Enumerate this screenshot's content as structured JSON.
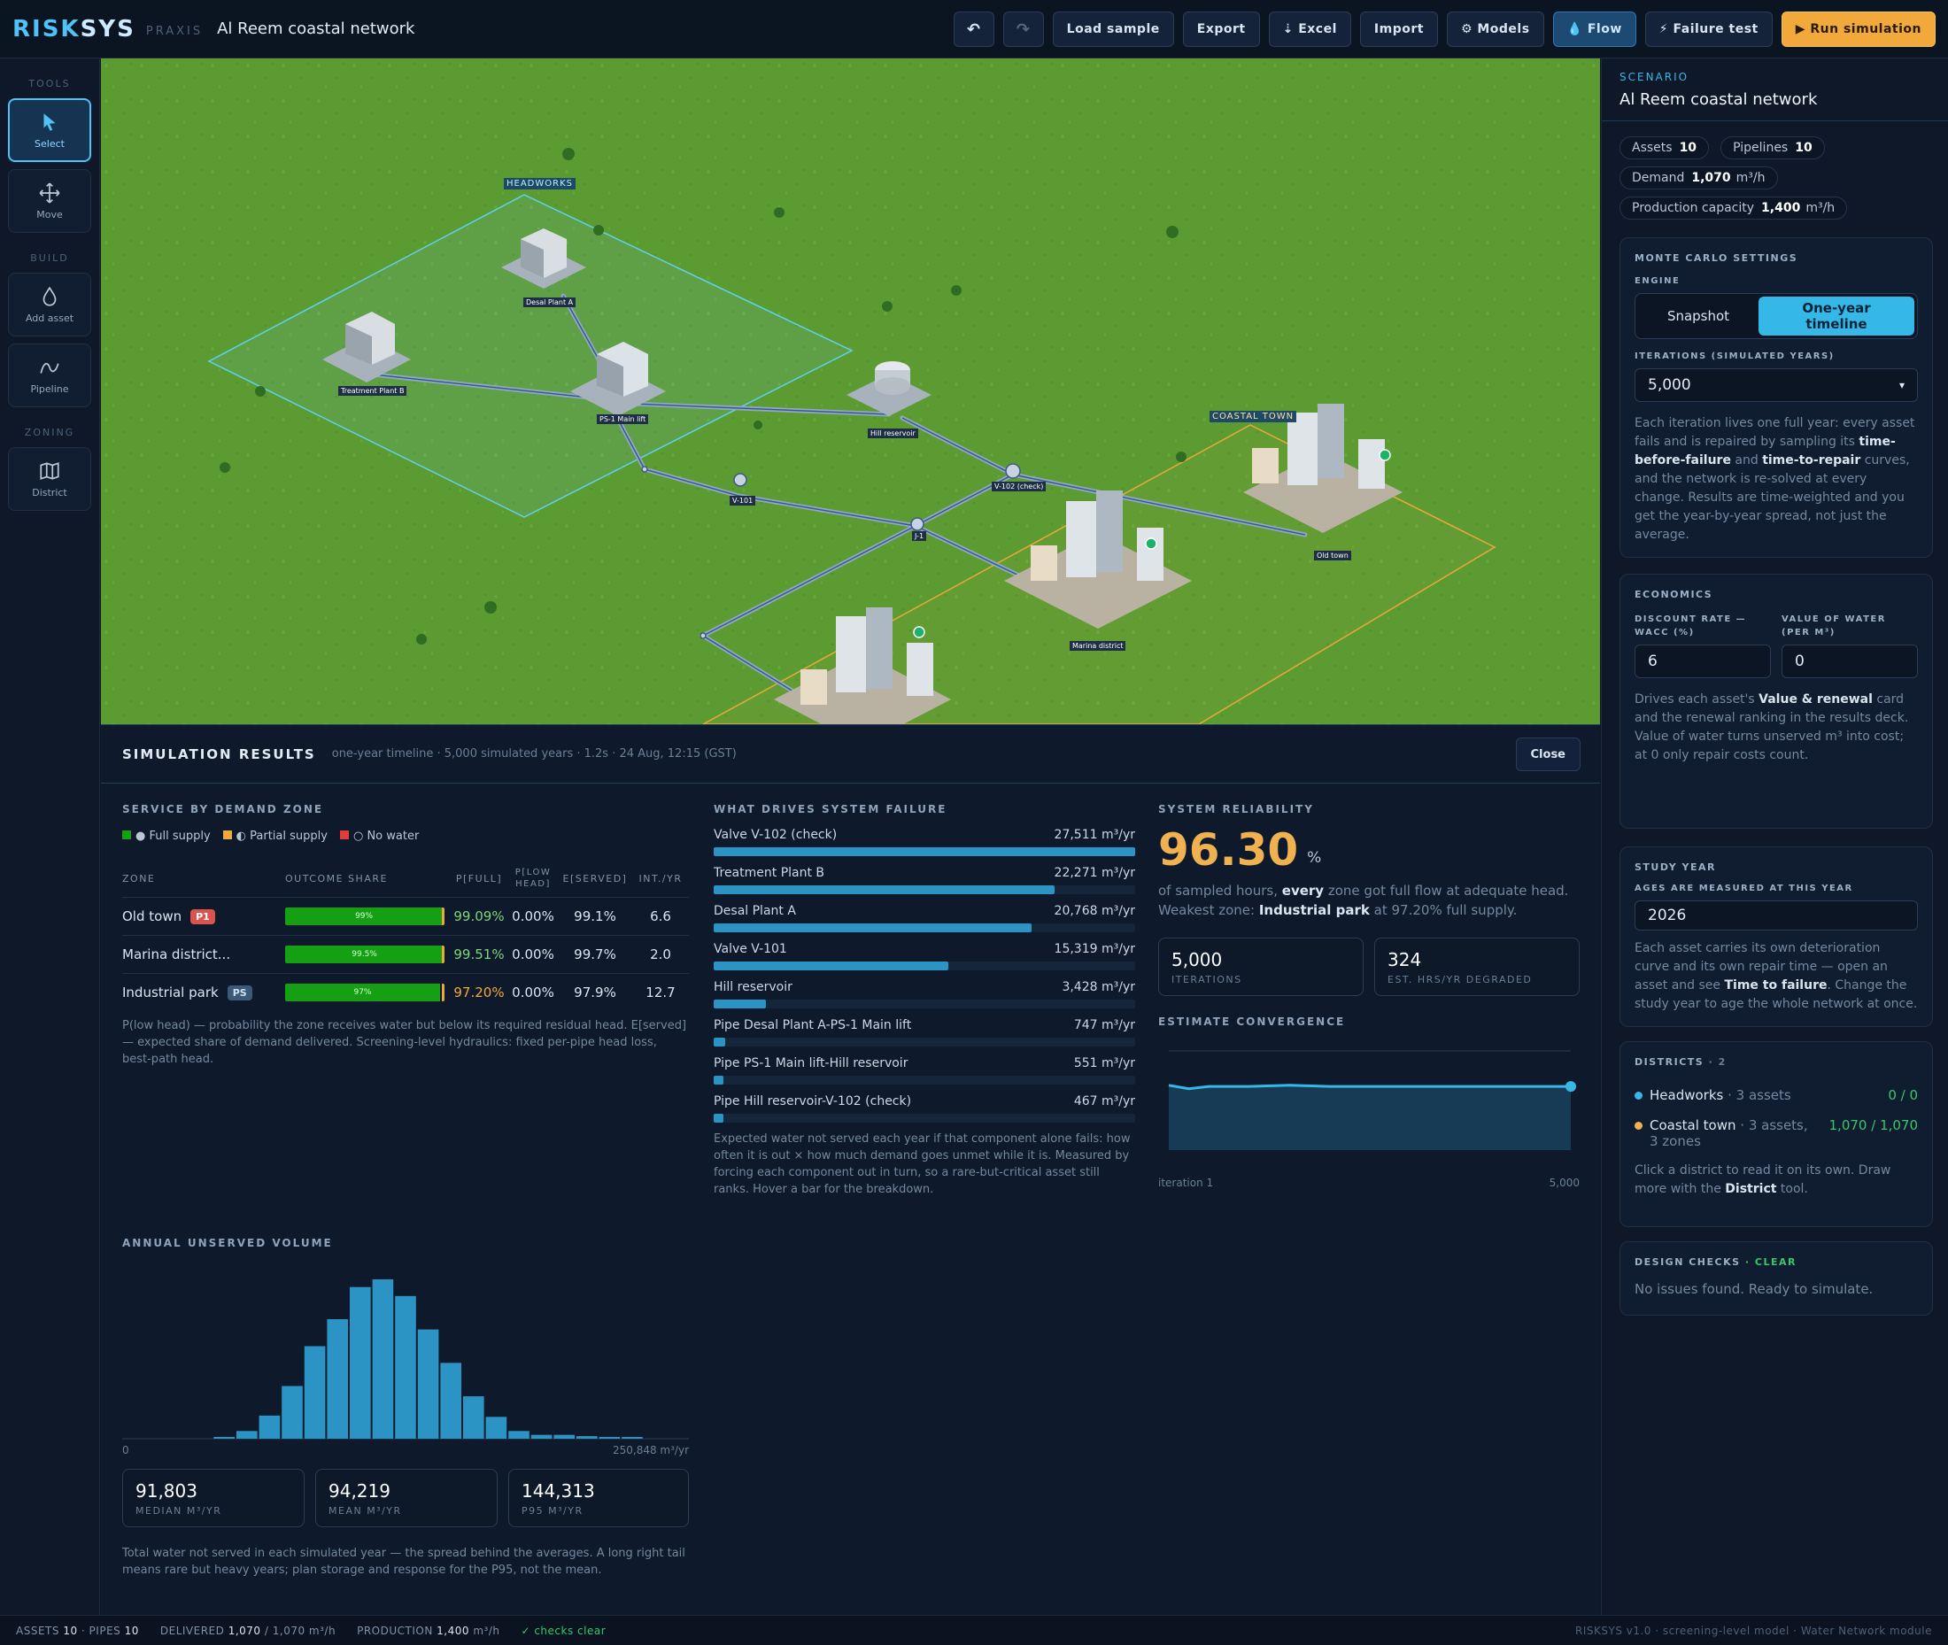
{
  "app": {
    "name_a": "RISK",
    "name_b": "SYS",
    "sub": "PRAXIS",
    "project": "Al Reem coastal network"
  },
  "toolbar": {
    "undo": "↶",
    "redo": "↷",
    "load_sample": "Load sample",
    "export": "Export",
    "excel": "⇣ Excel",
    "import": "Import",
    "models": "⚙ Models",
    "flow": "💧 Flow",
    "failure": "⚡ Failure test",
    "run": "▶ Run simulation"
  },
  "tools": {
    "sec_tools": "TOOLS",
    "select": "Select",
    "move": "Move",
    "sec_build": "BUILD",
    "add_asset": "Add asset",
    "pipeline": "Pipeline",
    "sec_zoning": "ZONING",
    "district": "District"
  },
  "map": {
    "headworks": "HEADWORKS",
    "coastal": "COASTAL TOWN",
    "desal": "Desal Plant A",
    "treatment": "Treatment Plant B",
    "ps1": "PS-1 Main lift",
    "hill": "Hill reservoir",
    "v101": "V-101",
    "v102": "V-102 (check)",
    "j1": "J-1",
    "oldtown": "Old town",
    "marina": "Marina district"
  },
  "results": {
    "title": "SIMULATION RESULTS",
    "meta": "one-year timeline · 5,000 simulated years · 1.2s · 24 Aug, 12:15 (GST)",
    "close": "Close",
    "zones_head": "SERVICE BY DEMAND ZONE",
    "legend": {
      "full": "● Full supply",
      "partial": "◐ Partial supply",
      "none": "○ No water"
    },
    "cols": {
      "zone": "ZONE",
      "share": "OUTCOME SHARE",
      "pfull": "P[FULL]",
      "plow": "P[LOW HEAD]",
      "eserved": "E[SERVED]",
      "int": "INT./YR"
    },
    "zones": [
      {
        "name": "Old town",
        "badge": "P1",
        "bar": "99%",
        "share": 0.99,
        "pfull": "99.09%",
        "plow": "0.00%",
        "eserved": "99.1%",
        "int": "6.6",
        "color": "#7ed67a"
      },
      {
        "name": "Marina district...",
        "badge": "",
        "bar": "99.5%",
        "share": 0.995,
        "pfull": "99.51%",
        "plow": "0.00%",
        "eserved": "99.7%",
        "int": "2.0",
        "color": "#7ed67a"
      },
      {
        "name": "Industrial park",
        "badge": "PS",
        "bar": "97%",
        "share": 0.972,
        "pfull": "97.20%",
        "plow": "0.00%",
        "eserved": "97.9%",
        "int": "12.7",
        "color": "#f0a93a"
      }
    ],
    "zones_note": "P(low head) — probability the zone receives water but below its required residual head. E[served] — expected share of demand delivered. Screening-level hydraulics: fixed per-pipe head loss, best-path head.",
    "drivers_head": "WHAT DRIVES SYSTEM FAILURE",
    "drivers": [
      {
        "name": "Valve V-102 (check)",
        "val": "27,511 m³/yr",
        "v": 27511
      },
      {
        "name": "Treatment Plant B",
        "val": "22,271 m³/yr",
        "v": 22271
      },
      {
        "name": "Desal Plant A",
        "val": "20,768 m³/yr",
        "v": 20768
      },
      {
        "name": "Valve V-101",
        "val": "15,319 m³/yr",
        "v": 15319
      },
      {
        "name": "Hill reservoir",
        "val": "3,428 m³/yr",
        "v": 3428
      },
      {
        "name": "Pipe Desal Plant A-PS-1 Main lift",
        "val": "747 m³/yr",
        "v": 747
      },
      {
        "name": "Pipe PS-1 Main lift-Hill reservoir",
        "val": "551 m³/yr",
        "v": 551
      },
      {
        "name": "Pipe Hill reservoir-V-102 (check)",
        "val": "467 m³/yr",
        "v": 467
      }
    ],
    "drivers_note": "Expected water not served each year if that component alone fails: how often it is out × how much demand goes unmet while it is. Measured by forcing each component out in turn, so a rare-but-critical asset still ranks. Hover a bar for the breakdown.",
    "rel_head": "SYSTEM RELIABILITY",
    "rel_value": "96.30",
    "rel_unit": "%",
    "rel_text_a": "of sampled hours,",
    "rel_text_b": "every",
    "rel_text_c": "zone got full flow at adequate head.",
    "rel_text_d": "Weakest zone:",
    "rel_text_e": "Industrial park",
    "rel_text_f": "at 97.20% full supply.",
    "iter_v": "5,000",
    "iter_k": "ITERATIONS",
    "hrs_v": "324",
    "hrs_k": "EST. HRS/YR DEGRADED",
    "conv_head": "ESTIMATE CONVERGENCE",
    "conv_start": "iteration 1",
    "conv_end": "5,000",
    "hist_head": "ANNUAL UNSERVED VOLUME",
    "hist_min": "0",
    "hist_max": "250,848 m³/yr",
    "median_v": "91,803",
    "median_k": "MEDIAN M³/YR",
    "mean_v": "94,219",
    "mean_k": "MEAN M³/YR",
    "p95_v": "144,313",
    "p95_k": "P95 M³/YR",
    "hist_note": "Total water not served in each simulated year — the spread behind the averages. A long right tail means rare but heavy years; plan storage and response for the P95, not the mean."
  },
  "chart_data": [
    {
      "type": "bar",
      "title": "ANNUAL UNSERVED VOLUME",
      "xlim": [
        0,
        250848
      ],
      "values": [
        0,
        0,
        0,
        0,
        1,
        6,
        18,
        41,
        72,
        93,
        118,
        124,
        111,
        85,
        59,
        33,
        17,
        6,
        3,
        3,
        2,
        1,
        1,
        0,
        0
      ],
      "color": "#2b94c4"
    },
    {
      "type": "line",
      "title": "ESTIMATE CONVERGENCE",
      "x": [
        1,
        250,
        500,
        1000,
        1500,
        2000,
        2500,
        3000,
        3500,
        4000,
        4500,
        5000
      ],
      "values": [
        96.4,
        96.1,
        96.3,
        96.3,
        96.4,
        96.3,
        96.3,
        96.3,
        96.3,
        96.3,
        96.3,
        96.3
      ],
      "color": "#35b8e8"
    }
  ],
  "right": {
    "scen_lbl": "SCENARIO",
    "scen_name": "Al Reem coastal network",
    "assets_k": "Assets",
    "assets_v": "10",
    "pipes_k": "Pipelines",
    "pipes_v": "10",
    "demand_k": "Demand",
    "demand_v": "1,070",
    "demand_u": "m³/h",
    "prod_k": "Production capacity",
    "prod_v": "1,400",
    "prod_u": "m³/h",
    "mc_head": "MONTE CARLO SETTINGS",
    "engine": "ENGINE",
    "snapshot": "Snapshot",
    "timeline": "One-year timeline",
    "iter_lbl": "ITERATIONS (SIMULATED YEARS)",
    "iter_val": "5,000",
    "mc_note_a": "Each iteration lives one full year: every asset fails and is repaired by sampling its",
    "mc_note_b": "time-before-failure",
    "mc_note_c": "and",
    "mc_note_d": "time-to-repair",
    "mc_note_e": "curves, and the network is re-solved at every change. Results are time-weighted and you get the year-by-year spread, not just the average.",
    "eco_head": "ECONOMICS",
    "disc_lbl": "DISCOUNT RATE — WACC (%)",
    "disc_val": "6",
    "vow_lbl": "VALUE OF WATER (PER M³)",
    "vow_val": "0",
    "eco_note_a": "Drives each asset's",
    "eco_note_b": "Value & renewal",
    "eco_note_c": "card and the renewal ranking in the results deck. Value of water turns unserved m³ into cost; at 0 only repair costs count.",
    "study_head": "STUDY YEAR",
    "study_lbl": "AGES ARE MEASURED AT THIS YEAR",
    "study_val": "2026",
    "study_note_a": "Each asset carries its own deterioration curve and its own repair time — open an asset and see",
    "study_note_b": "Time to failure",
    "study_note_c": ". Change the study year to age the whole network at once.",
    "dist_head": "DISTRICTS",
    "dist_count": "· 2",
    "d1_name": "Headworks",
    "d1_meta": "· 3 assets",
    "d1_val": "0 / 0",
    "d2_name": "Coastal town",
    "d2_meta": "· 3 assets,",
    "d2_meta2": "3 zones",
    "d2_val": "1,070 / 1,070",
    "dist_note_a": "Click a district to read it on its own. Draw more with the",
    "dist_note_b": "District",
    "dist_note_c": "tool.",
    "dc_head": "DESIGN CHECKS",
    "dc_status": "· CLEAR",
    "dc_note": "No issues found. Ready to simulate."
  },
  "status": {
    "assets": "ASSETS",
    "assets_v": "10",
    "pipes": "· PIPES",
    "pipes_v": "10",
    "delivered": "DELIVERED",
    "delivered_v": "1,070",
    "delivered_tail": "/ 1,070 m³/h",
    "production": "PRODUCTION",
    "production_v": "1,400",
    "production_u": "m³/h",
    "checks": "✓ checks clear",
    "right": "RISKSYS v1.0 · screening-level model · Water Network module"
  }
}
